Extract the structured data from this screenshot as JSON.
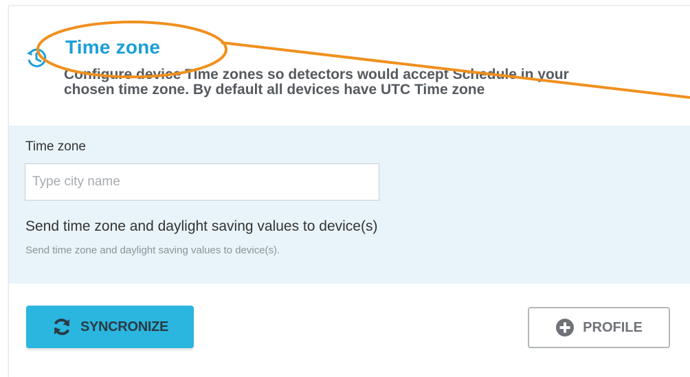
{
  "section": {
    "title": "Time zone",
    "description_line1": "Configure device Time zones so detectors would accept Schedule in your",
    "description_line2": "chosen time zone. By default all devices have UTC Time zone",
    "icon": "clock-history-icon"
  },
  "form": {
    "timezone_label": "Time zone",
    "timezone_value": "",
    "timezone_placeholder": "Type city name",
    "send_title": "Send time zone and daylight saving values to device(s)",
    "send_help": "Send time zone and daylight saving values to device(s)."
  },
  "buttons": {
    "sync_label": "SYNCRONIZE",
    "sync_icon": "refresh-icon",
    "profile_label": "PROFILE",
    "profile_icon": "plus-circle-icon"
  },
  "colors": {
    "accent": "#1a9fd8",
    "sync_button": "#2bb6df",
    "panel_bg": "#e8f4fa",
    "annotation": "#f0901e"
  }
}
